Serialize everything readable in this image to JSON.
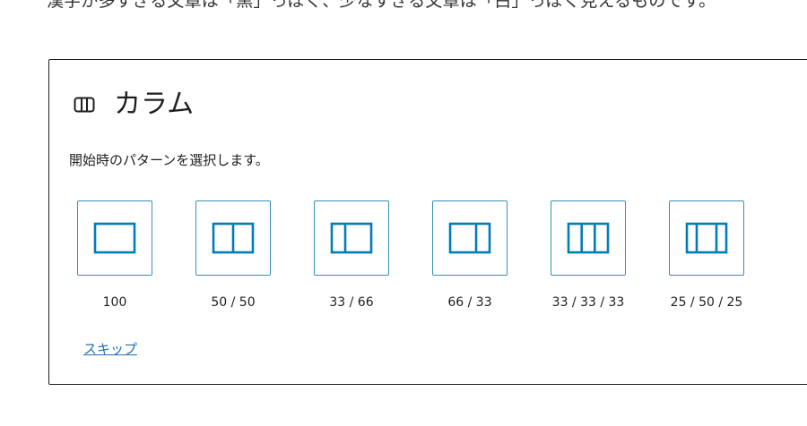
{
  "body_text": "漢字が多すぎる文章は「黒」っぽく、少なすぎる文章は「白」っぽく見えるものです。",
  "placeholder": {
    "icon": "columns-block-icon",
    "title": "カラム",
    "instructions": "開始時のパターンを選択します。",
    "variations": [
      {
        "label": "100",
        "icon": "one-column-icon"
      },
      {
        "label": "50 / 50",
        "icon": "two-columns-equal-icon"
      },
      {
        "label": "33 / 66",
        "icon": "two-columns-one-third-two-thirds-icon"
      },
      {
        "label": "66 / 33",
        "icon": "two-columns-two-thirds-one-third-icon"
      },
      {
        "label": "33 / 33 / 33",
        "icon": "three-columns-equal-icon"
      },
      {
        "label": "25 / 50 / 25",
        "icon": "three-columns-wider-center-icon"
      }
    ],
    "skip_label": "スキップ"
  },
  "colors": {
    "accent": "#007cba",
    "variation_border": "#3a8fb3",
    "link": "#2271b1",
    "text": "#1e1e1e"
  }
}
